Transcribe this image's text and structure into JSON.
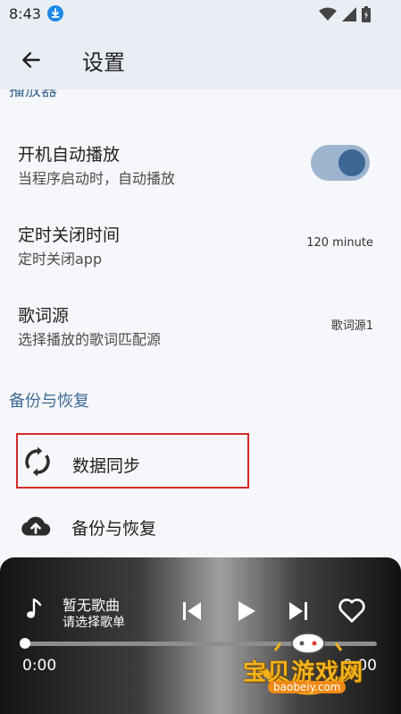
{
  "status_bar": {
    "time": "8:43"
  },
  "app_bar": {
    "title": "设置"
  },
  "sections": {
    "player_clipped": "播放器",
    "backup": "备份与恢复"
  },
  "settings": {
    "autoplay": {
      "title": "开机自动播放",
      "subtitle": "当程序启动时，自动播放",
      "enabled": true
    },
    "sleep_timer": {
      "title": "定时关闭时间",
      "subtitle": "定时关闭app",
      "value": "120 minute"
    },
    "lyrics_source": {
      "title": "歌词源",
      "subtitle": "选择播放的歌词匹配源",
      "value": "歌词源1"
    }
  },
  "backup_items": {
    "sync": {
      "label": "数据同步",
      "icon": "sync-icon"
    },
    "backup_restore": {
      "label": "备份与恢复",
      "icon": "cloud-upload-icon"
    }
  },
  "player": {
    "song_title": "暂无歌曲",
    "song_subtitle": "请选择歌单",
    "current_time": "0:00",
    "total_time": "0:00",
    "progress": 0
  },
  "watermark": {
    "brand": "宝贝游戏网",
    "url": "baobeiy.com"
  },
  "colors": {
    "accent": "#3e6796",
    "section": "#3f6a93",
    "highlight_border": "#d42a2a"
  }
}
